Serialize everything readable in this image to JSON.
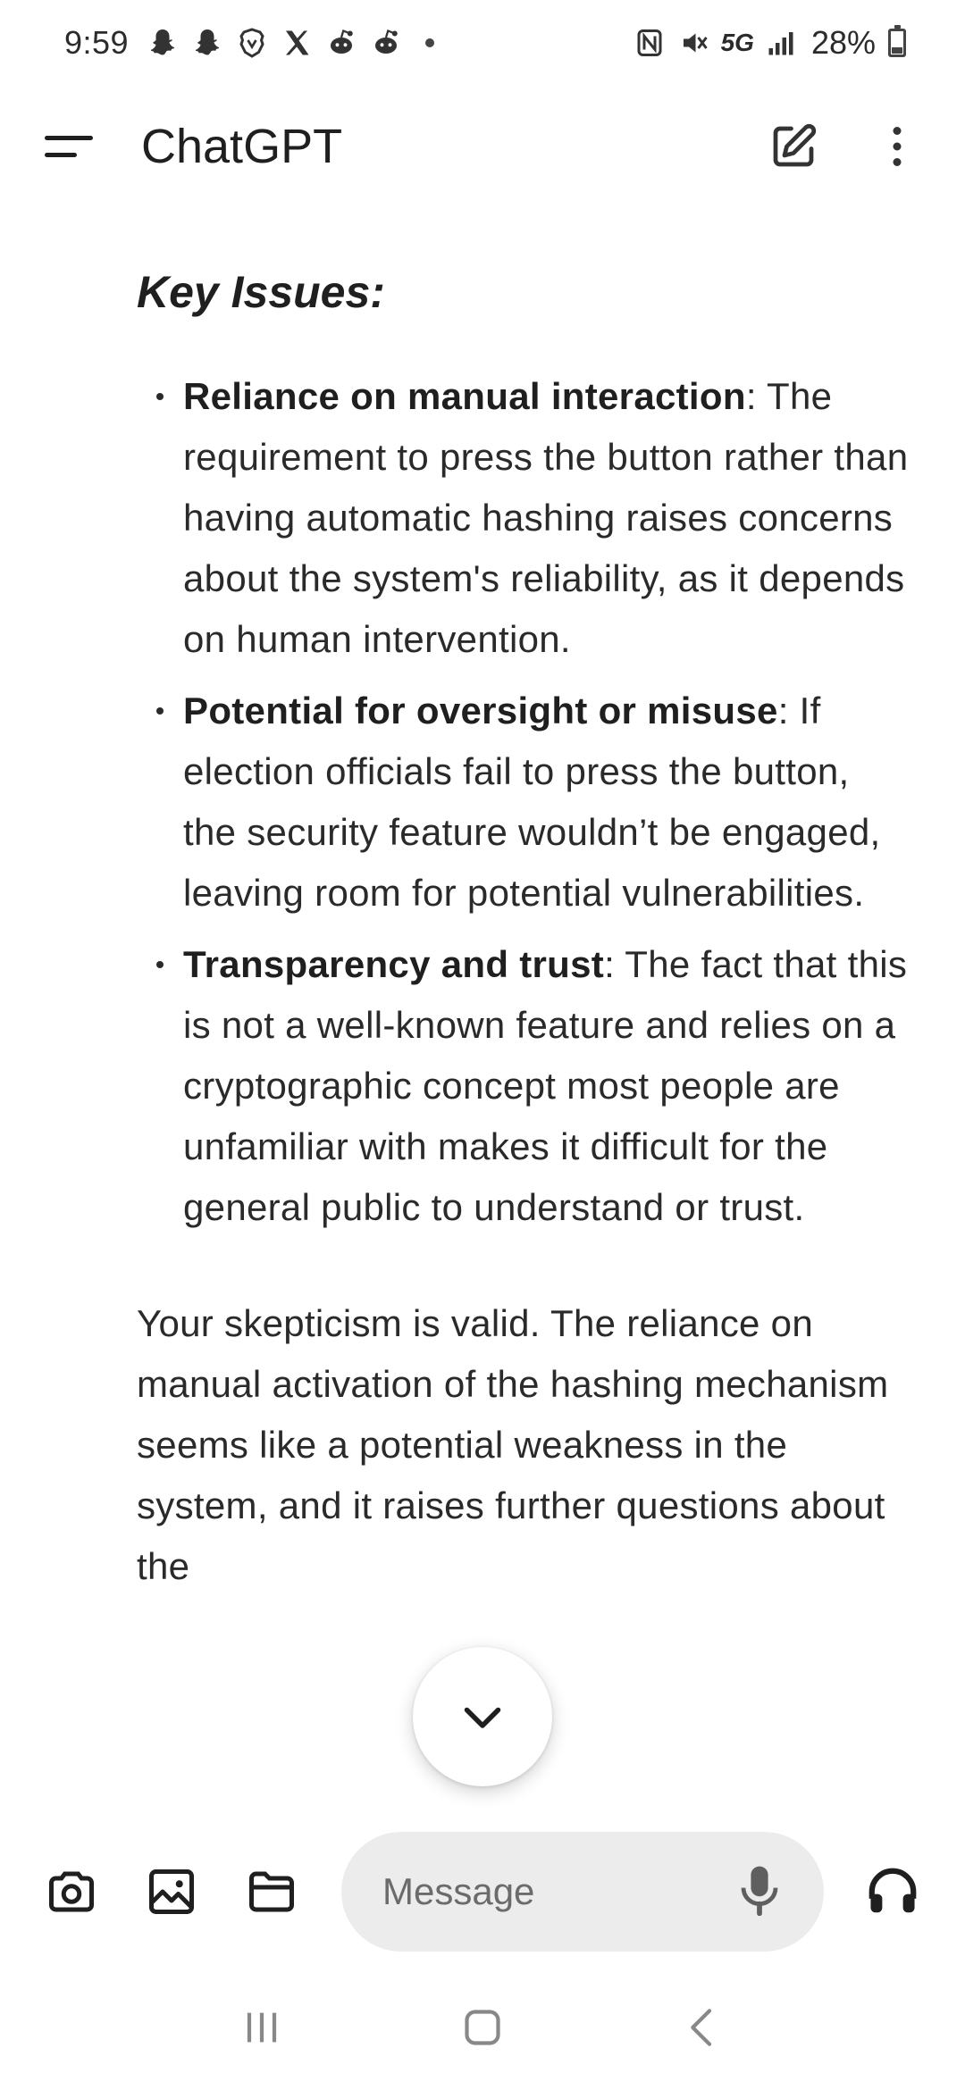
{
  "status_bar": {
    "time": "9:59",
    "network": "5G",
    "battery": "28%",
    "battery_level": 0.28,
    "icons": [
      "snapchat-icon",
      "snapchat-icon",
      "brave-icon",
      "x-icon",
      "reddit-icon",
      "reddit-icon",
      "nfc-icon",
      "mute-icon",
      "signal-icon",
      "battery-icon"
    ]
  },
  "app_bar": {
    "title": "ChatGPT",
    "icons": [
      "menu-icon",
      "new-chat-icon",
      "more-vert-icon"
    ]
  },
  "content": {
    "heading": "Key Issues:",
    "bullets": [
      {
        "title": "Reliance on manual interaction",
        "text": ": The requirement to press the button rather than having automatic hashing raises concerns about the system's reliability, as it depends on human intervention."
      },
      {
        "title": "Potential for oversight or misuse",
        "text": ": If election officials fail to press the button, the security feature wouldn’t be engaged, leaving room for potential vulnerabilities."
      },
      {
        "title": "Transparency and trust",
        "text": ": The fact that this is not a well-known feature and relies on a cryptographic concept most people are unfamiliar with makes it difficult for the general public to understand or trust."
      }
    ],
    "paragraph": "Your skepticism is valid. The reliance on manual activation of the hashing mechanism seems like a potential weakness in the system, and it raises further questions about the"
  },
  "scroll_button": {
    "icon": "chevron-down-icon"
  },
  "input_bar": {
    "placeholder": "Message",
    "tools": [
      "camera-icon",
      "image-icon",
      "folder-icon"
    ],
    "mic_icon": "mic-icon",
    "voice_icon": "headphones-icon"
  },
  "nav_bar": {
    "icons": [
      "recents-icon",
      "home-icon",
      "back-icon"
    ]
  },
  "colors": {
    "text": "#1f1f1f",
    "input_bg": "#ececec",
    "background": "#ffffff"
  }
}
